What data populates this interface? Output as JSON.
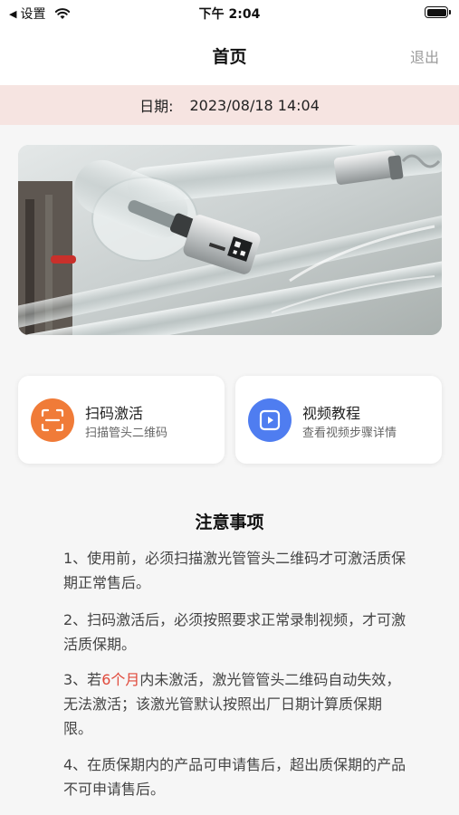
{
  "status_bar": {
    "back_app": "设置",
    "time": "下午 2:04",
    "battery_level": 1.0
  },
  "nav": {
    "title": "首页",
    "logout": "退出"
  },
  "date_bar": {
    "label": "日期:",
    "value": "2023/08/18 14:04"
  },
  "banner": {
    "icon": "laser-tube-photo"
  },
  "cards": {
    "scan": {
      "title": "扫码激活",
      "subtitle": "扫描管头二维码",
      "icon": "scan-frame-icon",
      "color": "#f07b38"
    },
    "video": {
      "title": "视频教程",
      "subtitle": "查看视频步骤详情",
      "icon": "play-icon",
      "color": "#4f7df0"
    }
  },
  "notes": {
    "title": "注意事项",
    "item1": "1、使用前，必须扫描激光管管头二维码才可激活质保期正常售后。",
    "item2": "2、扫码激活后，必须按照要求正常录制视频，才可激活质保期。",
    "item3_before": "3、若",
    "item3_highlight": "6个月",
    "item3_after": "内未激活，激光管管头二维码自动失效，无法激活；该激光管默认按照出厂日期计算质保期限。",
    "item4": "4、在质保期内的产品可申请售后，超出质保期的产品不可申请售后。",
    "highlight_color": "#e0483a"
  }
}
